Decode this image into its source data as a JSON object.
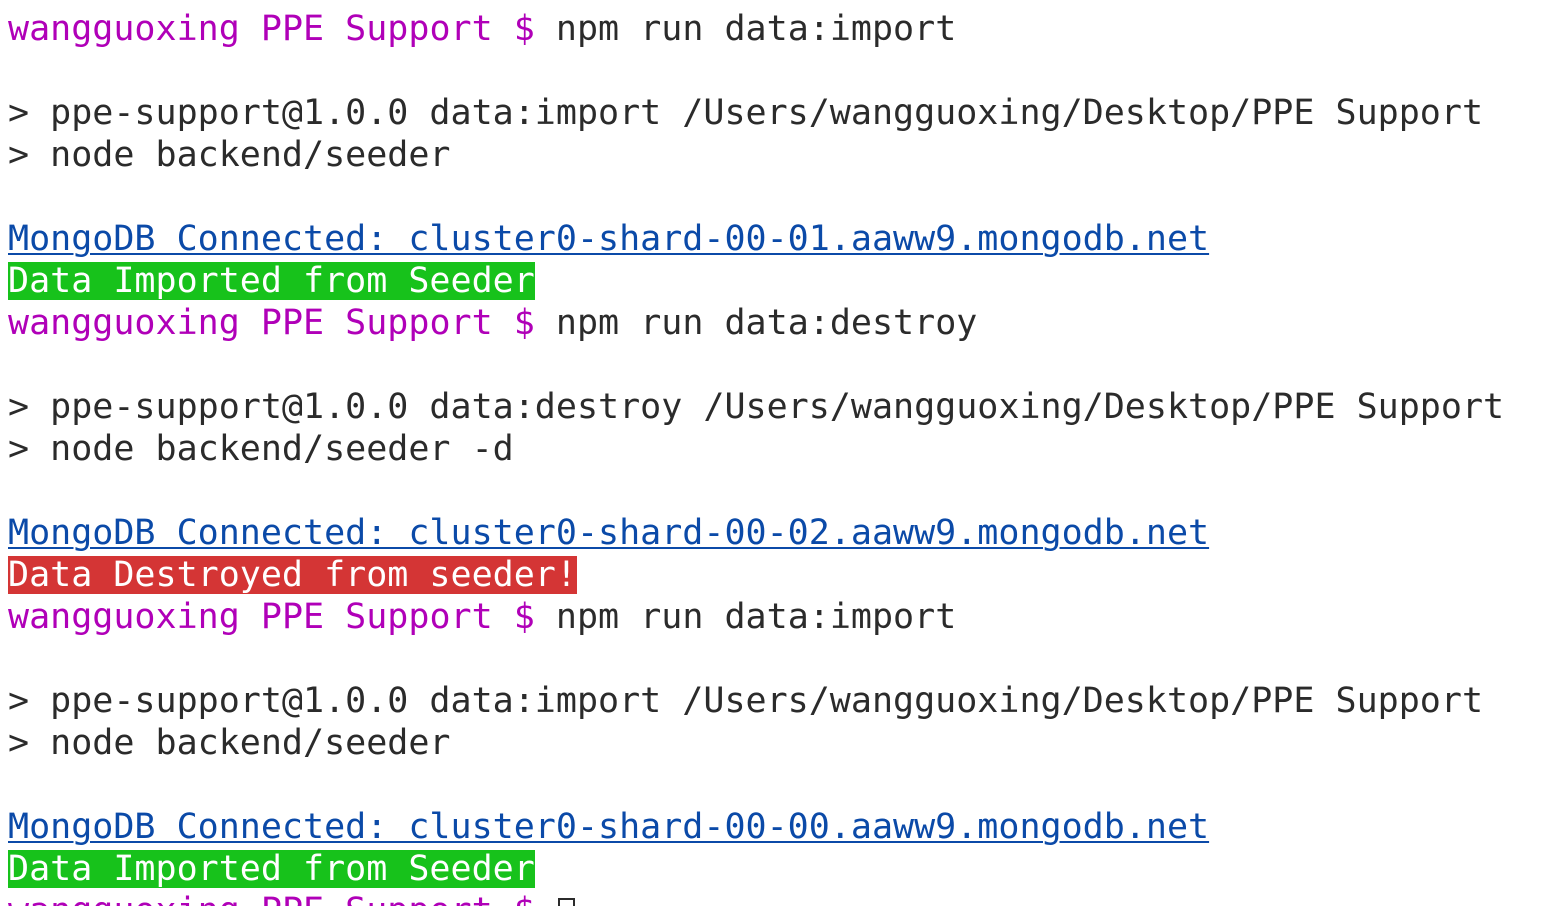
{
  "prompt": {
    "user": "wangguoxing",
    "dir": "PPE Support",
    "symbol": "$"
  },
  "blocks": [
    {
      "command": "npm run data:import",
      "output": [
        "> ppe-support@1.0.0 data:import /Users/wangguoxing/Desktop/PPE Support",
        "> node backend/seeder"
      ],
      "mongo": "MongoDB Connected: cluster0-shard-00-01.aaww9.mongodb.net",
      "result": "Data Imported from Seeder",
      "status": "success"
    },
    {
      "command": "npm run data:destroy",
      "output": [
        "> ppe-support@1.0.0 data:destroy /Users/wangguoxing/Desktop/PPE Support",
        "> node backend/seeder -d"
      ],
      "mongo": "MongoDB Connected: cluster0-shard-00-02.aaww9.mongodb.net",
      "result": "Data Destroyed from seeder!",
      "status": "error"
    },
    {
      "command": "npm run data:import",
      "output": [
        "> ppe-support@1.0.0 data:import /Users/wangguoxing/Desktop/PPE Support",
        "> node backend/seeder"
      ],
      "mongo": "MongoDB Connected: cluster0-shard-00-00.aaww9.mongodb.net",
      "result": "Data Imported from Seeder",
      "status": "success"
    }
  ],
  "colors": {
    "prompt": "#b000b8",
    "text": "#2b2b2b",
    "link": "#0b4aa8",
    "success_bg": "#17c21b",
    "error_bg": "#d43535"
  }
}
